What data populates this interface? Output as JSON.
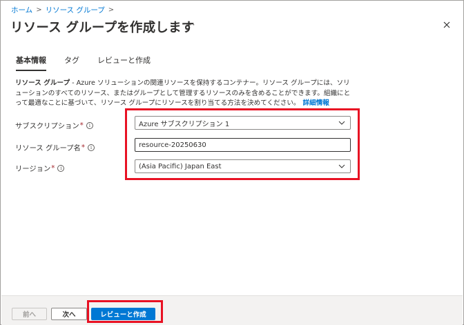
{
  "breadcrumb": {
    "home": "ホーム",
    "separator": ">",
    "resource_groups": "リソース グループ"
  },
  "header": {
    "title": "リソース グループを作成します",
    "more": "···"
  },
  "tabs": [
    {
      "label": "基本情報"
    },
    {
      "label": "タグ"
    },
    {
      "label": "レビューと作成"
    }
  ],
  "description": {
    "term": "リソース グループ",
    "text": " - Azure ソリューションの関連リソースを保持するコンテナー。リソース グループには、ソリューションのすべてのリソース、またはグループとして管理するリソースのみを含めることができます。組織にとって最適なことに基づいて、リソース グループにリソースを割り当てる方法を決めてください。",
    "link": "詳細情報"
  },
  "form": {
    "subscription": {
      "label": "サブスクリプション",
      "required": "*",
      "value": "Azure サブスクリプション 1"
    },
    "resource_group_name": {
      "label": "リソース グループ名",
      "required": "*",
      "value": "resource-20250630"
    },
    "region": {
      "label": "リージョン",
      "required": "*",
      "value": "(Asia Pacific) Japan East"
    },
    "info_glyph": "i"
  },
  "footer": {
    "prev": "前へ",
    "next": "次へ",
    "review_create": "レビューと作成"
  },
  "colors": {
    "accent": "#0078d4",
    "highlight": "#e81123",
    "required": "#a4262c"
  },
  "icons": {
    "close": "close-icon",
    "chevron": "chevron-down-icon",
    "info": "info-icon"
  }
}
